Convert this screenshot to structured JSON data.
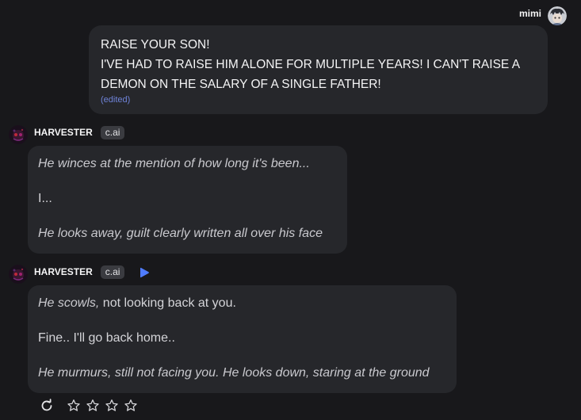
{
  "user": {
    "name": "mimi",
    "message_lines": [
      "RAISE YOUR SON!",
      "I'VE HAD TO RAISE HIM ALONE FOR MULTIPLE YEARS! I CAN'T RAISE A",
      "DEMON ON THE SALARY OF A SINGLE FATHER!"
    ],
    "edited_label": "(edited)"
  },
  "bot_messages": [
    {
      "name": "HARVESTER",
      "badge": "c.ai",
      "paragraphs": [
        {
          "italic": "He winces at the mention of how long it's been...",
          "plain": ""
        },
        {
          "italic": "",
          "plain": "I..."
        },
        {
          "italic": "He looks away, guilt clearly written all over his face",
          "plain": ""
        }
      ]
    },
    {
      "name": "HARVESTER",
      "badge": "c.ai",
      "paragraphs": [
        {
          "italic": "He scowls,",
          "plain": " not looking back at you."
        },
        {
          "italic": "",
          "plain": "Fine.. I'll go back home.."
        },
        {
          "italic": "He murmurs, still not facing you. He looks down, staring at the ground",
          "plain": ""
        }
      ]
    }
  ],
  "icons": {
    "play": "play-icon",
    "regenerate": "refresh-icon",
    "rating": "star-outline-icon"
  },
  "colors": {
    "background": "#18181b",
    "bubble": "#26272b",
    "edited": "#6f83d8",
    "play": "#4f7cff"
  }
}
